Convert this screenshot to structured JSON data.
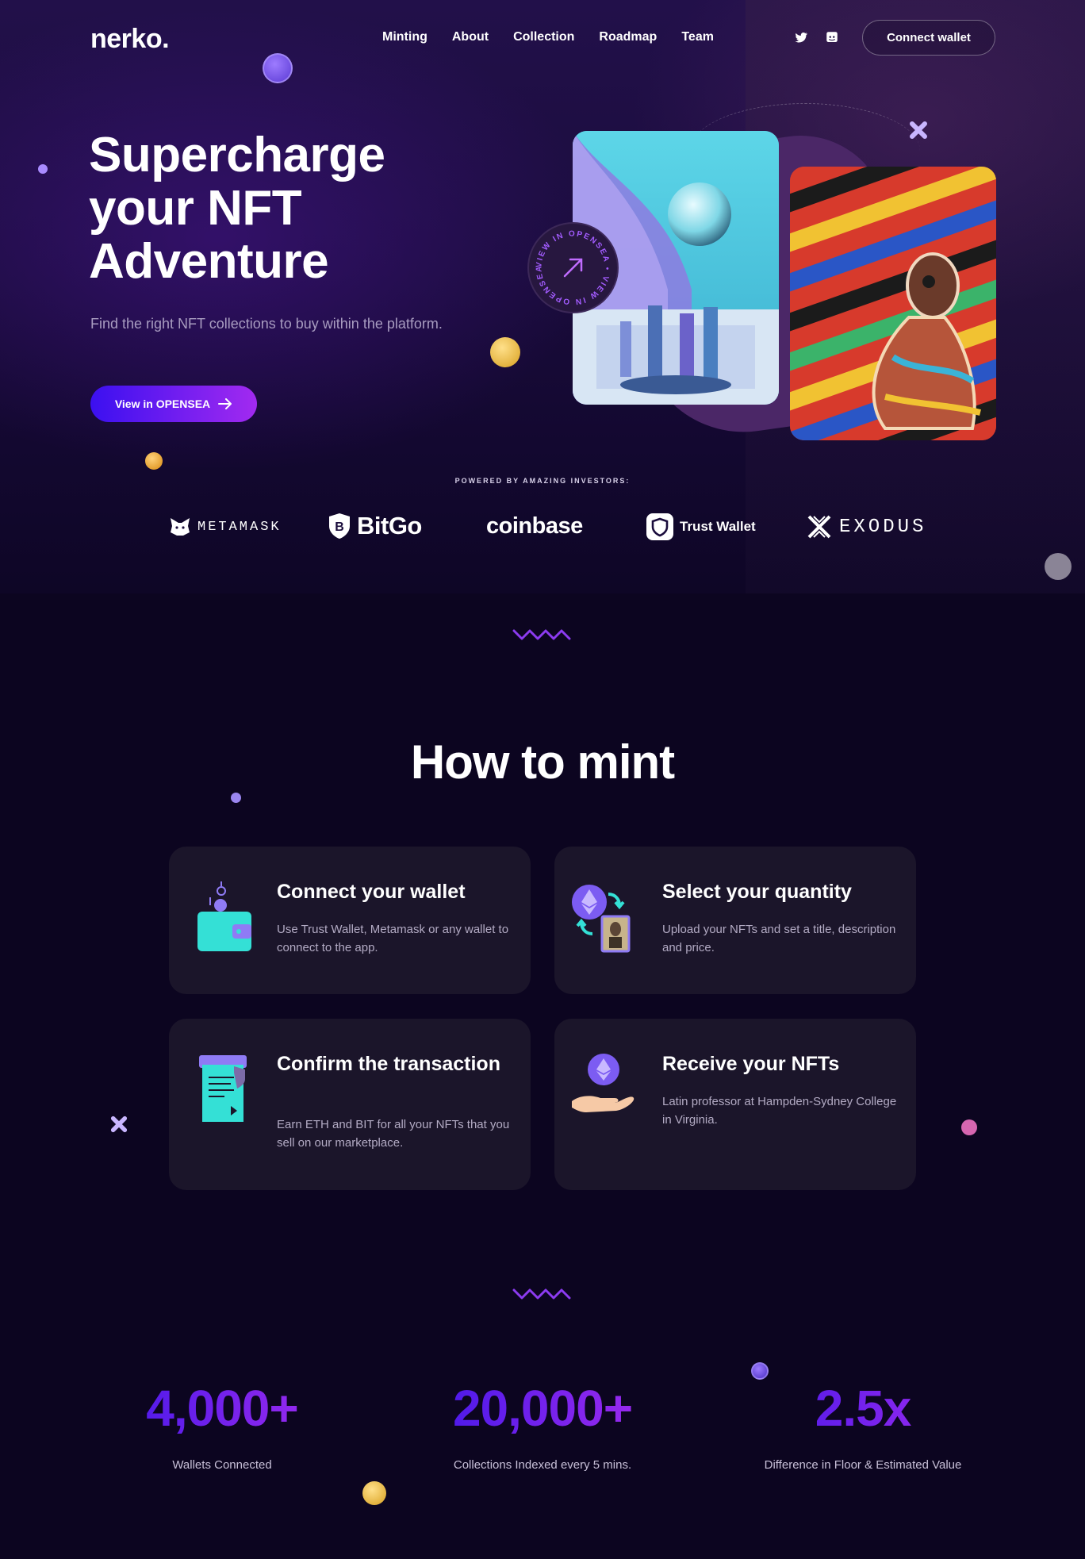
{
  "brand": {
    "logo": "nerko."
  },
  "nav": {
    "items": [
      {
        "label": "Minting"
      },
      {
        "label": "About"
      },
      {
        "label": "Collection"
      },
      {
        "label": "Roadmap"
      },
      {
        "label": "Team"
      }
    ],
    "social_icons": [
      "twitter-icon",
      "discord-icon"
    ],
    "connect_label": "Connect wallet"
  },
  "hero": {
    "title": "Supercharge your NFT Adventure",
    "subtitle": "Find the right NFT collections to buy within the platform.",
    "cta_label": "View in OPENSEA",
    "cta_icon": "arrow-right-icon",
    "badge_text": "VIEW IN OPENSEA • VIEW IN OPENSEA •",
    "badge_icon": "arrow-up-right-icon"
  },
  "investors": {
    "label": "POWERED BY AMAZING INVESTORS:",
    "logos": [
      {
        "name": "METAMASK",
        "icon": "metamask-fox-icon"
      },
      {
        "name": "BitGo",
        "icon": "bitgo-shield-icon"
      },
      {
        "name": "coinbase",
        "icon": ""
      },
      {
        "name": "Trust Wallet",
        "icon": "trust-wallet-shield-icon"
      },
      {
        "name": "EXODUS",
        "icon": "exodus-x-icon"
      }
    ]
  },
  "how_to_mint": {
    "title": "How to mint",
    "steps": [
      {
        "title": "Connect your wallet",
        "description": "Use Trust Wallet, Metamask or any wallet to connect to the app.",
        "icon": "wallet-icon"
      },
      {
        "title": "Select your quantity",
        "description": "Upload your NFTs and set a title, description and price.",
        "icon": "exchange-nft-icon"
      },
      {
        "title": "Confirm the transaction",
        "description": "Earn ETH and BIT for all your NFTs that you sell on our marketplace.",
        "icon": "document-shield-icon"
      },
      {
        "title": "Receive your NFTs",
        "description": "Latin professor at Hampden-Sydney College in Virginia.",
        "icon": "hand-ethereum-icon"
      }
    ]
  },
  "stats": [
    {
      "value": "4,000+",
      "label": "Wallets Connected"
    },
    {
      "value": "20,000+",
      "label": "Collections Indexed every 5 mins."
    },
    {
      "value": "2.5x",
      "label": "Difference in Floor & Estimated Value"
    }
  ],
  "colors": {
    "background": "#0c0520",
    "card": "#1b152a",
    "accent_start": "#3b10f0",
    "accent_end": "#a22af0",
    "muted_text": "#a89cc0"
  }
}
